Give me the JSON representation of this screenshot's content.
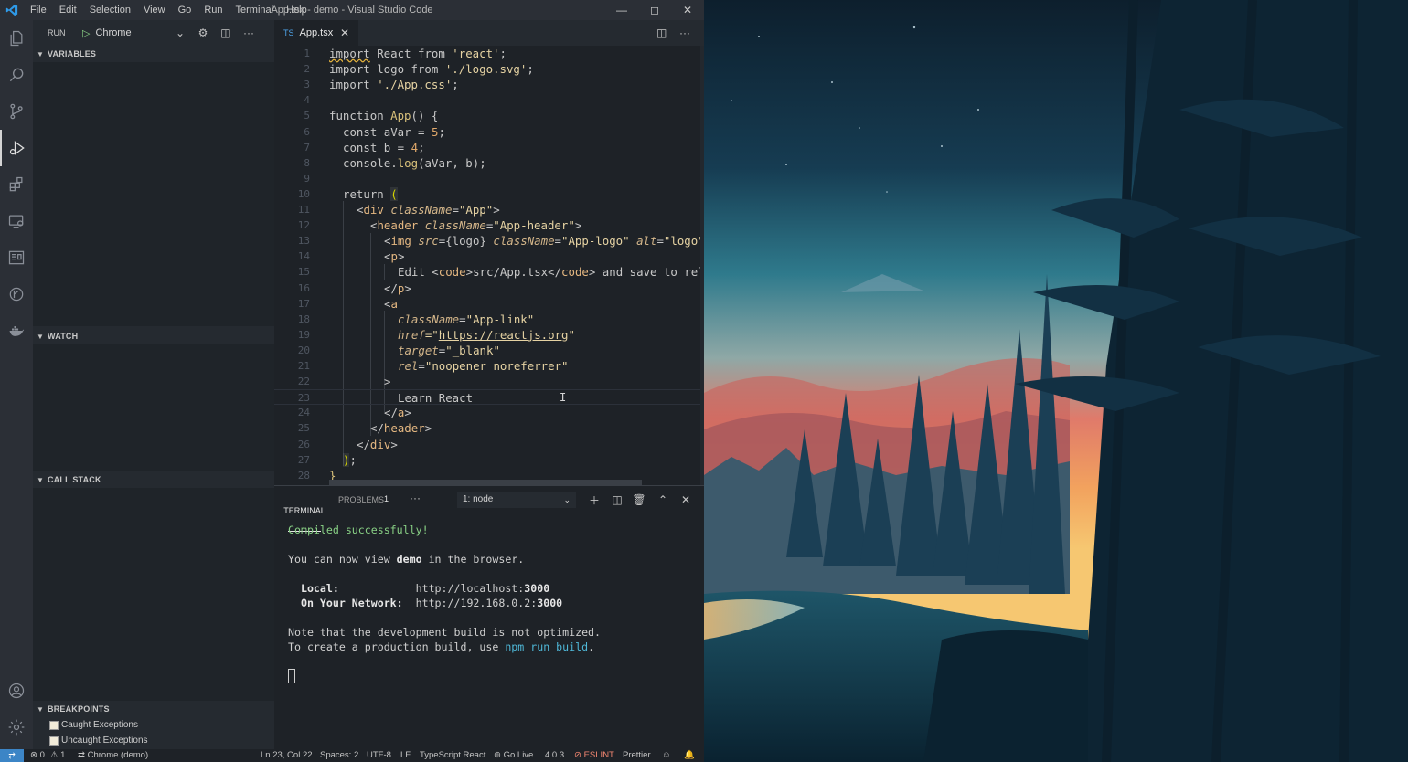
{
  "window": {
    "title": "App.tsx - demo - Visual Studio Code",
    "menu": [
      "File",
      "Edit",
      "Selection",
      "View",
      "Go",
      "Run",
      "Terminal",
      "Help"
    ]
  },
  "activity_bar": [
    "explorer-icon",
    "search-icon",
    "source-control-icon",
    "run-debug-icon",
    "extensions-icon",
    "remote-explorer-icon",
    "docs-icon",
    "git-graph-icon",
    "docker-icon",
    "account-icon",
    "settings-gear-icon"
  ],
  "sidebar": {
    "run_label": "RUN",
    "launch_config": "Chrome",
    "sections": {
      "variables": "VARIABLES",
      "watch": "WATCH",
      "call_stack": "CALL STACK",
      "breakpoints": "BREAKPOINTS"
    },
    "breakpoints": [
      "Caught Exceptions",
      "Uncaught Exceptions"
    ]
  },
  "editor": {
    "tab": "App.tsx",
    "tab_icon": "TS",
    "line_numbers": [
      "1",
      "2",
      "3",
      "4",
      "5",
      "6",
      "7",
      "8",
      "9",
      "10",
      "11",
      "12",
      "13",
      "14",
      "15",
      "16",
      "17",
      "18",
      "19",
      "20",
      "21",
      "22",
      "23",
      "24",
      "25",
      "26",
      "27",
      "28"
    ],
    "code": {
      "l1_import": "import",
      "l1_react": " React ",
      "l1_from": "from ",
      "l1_src": "'react'",
      "l1_end": ";",
      "l2": "import logo from ",
      "l2_src": "'./logo.svg'",
      "l2_end": ";",
      "l3": "import ",
      "l3_src": "'./App.css'",
      "l3_end": ";",
      "l5_kw": "function ",
      "l5_fn": "App",
      "l5_rest": "() {",
      "l6_a": "const aVar = ",
      "l6_n": "5",
      "l6_e": ";",
      "l7_a": "const b = ",
      "l7_n": "4",
      "l7_e": ";",
      "l8_a": "console.",
      "l8_fn": "log",
      "l8_b": "(aVar, b);",
      "l10_kw": "return ",
      "l10_br": "(",
      "l11_o": "<",
      "l11_t": "div ",
      "l11_at": "className",
      "l11_eq": "=",
      "l11_v": "\"App\"",
      "l11_c": ">",
      "l12_o": "<",
      "l12_t": "header ",
      "l12_at": "className",
      "l12_eq": "=",
      "l12_v": "\"App-header\"",
      "l12_c": ">",
      "l13_o": "<",
      "l13_t": "img ",
      "l13_at1": "src",
      "l13_eq1": "={logo} ",
      "l13_at2": "className",
      "l13_eq2": "=",
      "l13_v2": "\"App-logo\" ",
      "l13_at3": "alt",
      "l13_eq3": "=",
      "l13_v3": "\"logo\"",
      "l14_o": "<",
      "l14_t": "p",
      "l14_c": ">",
      "l15_a": "Edit <",
      "l15_t": "code",
      "l15_b": ">src/App.tsx</",
      "l15_t2": "code",
      "l15_c": "> and save to rel",
      "l16_o": "</",
      "l16_t": "p",
      "l16_c": ">",
      "l17_o": "<",
      "l17_t": "a",
      "l18_at": "className",
      "l18_eq": "=",
      "l18_v": "\"App-link\"",
      "l19_at": "href",
      "l19_eq": "=\"",
      "l19_v": "https://reactjs.org",
      "l19_q": "\"",
      "l20_at": "target",
      "l20_eq": "=",
      "l20_v": "\"_blank\"",
      "l21_at": "rel",
      "l21_eq": "=",
      "l21_v": "\"noopener noreferrer\"",
      "l22": ">",
      "l23": "Learn React",
      "l24_o": "</",
      "l24_t": "a",
      "l24_c": ">",
      "l25_o": "</",
      "l25_t": "header",
      "l25_c": ">",
      "l26_o": "</",
      "l26_t": "div",
      "l26_c": ">",
      "l27_br": ")",
      "l27_e": ";",
      "l28": "}"
    }
  },
  "panel": {
    "tabs": [
      "TERMINAL",
      "PROBLEMS"
    ],
    "problems_count": "1",
    "more": "···",
    "terminal_select": "1: node",
    "output": {
      "compiled": "Compiled successfully!",
      "view_a": "You can now view ",
      "view_b": "demo",
      "view_c": " in the browser.",
      "local_label": "  Local:",
      "local_pad": "            ",
      "local_url_a": "http://localhost:",
      "local_url_b": "3000",
      "network_label": "  On Your Network:",
      "network_pad": "  ",
      "network_url_a": "http://192.168.0.2:",
      "network_url_b": "3000",
      "note1": "Note that the development build is not optimized.",
      "note2_a": "To create a production build, use ",
      "note2_b": "npm run build",
      "note2_c": "."
    }
  },
  "statusbar": {
    "errors": "⊗ 0",
    "warnings": "⚠ 1",
    "debug_target": "⇄ Chrome (demo)",
    "position": "Ln 23, Col 22",
    "spaces": "Spaces: 2",
    "encoding": "UTF-8",
    "eol": "LF",
    "language": "TypeScript React",
    "golive": "⊚ Go Live",
    "ts_version": "4.0.3",
    "eslint": "⊘ ESLINT",
    "prettier": "Prettier"
  },
  "colors": {
    "accent": "#3c85c6",
    "activity_bar": "#2b2f36",
    "editor_bg": "#1e2227",
    "terminal_green": "#89d185"
  }
}
